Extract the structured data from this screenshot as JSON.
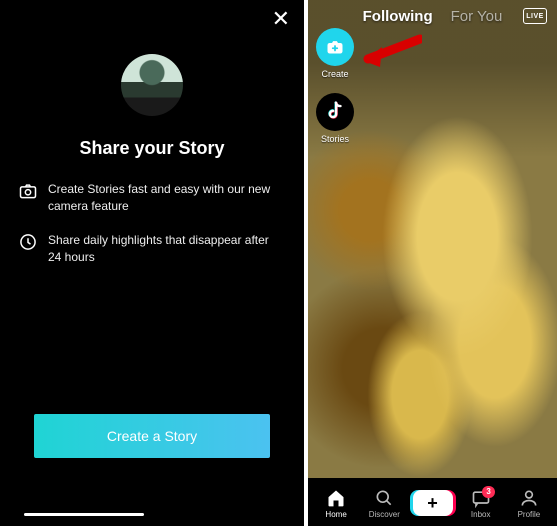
{
  "left": {
    "title": "Share your Story",
    "features": [
      {
        "text": "Create Stories fast and easy with our new camera feature"
      },
      {
        "text": "Share daily highlights that disappear after 24 hours"
      }
    ],
    "ctaLabel": "Create a Story"
  },
  "right": {
    "tabs": {
      "following": "Following",
      "foryou": "For You"
    },
    "liveLabel": "LIVE",
    "sideActions": {
      "create": "Create",
      "stories": "Stories"
    },
    "nav": {
      "home": "Home",
      "discover": "Discover",
      "inbox": "Inbox",
      "profile": "Profile",
      "inboxBadge": "3"
    }
  }
}
